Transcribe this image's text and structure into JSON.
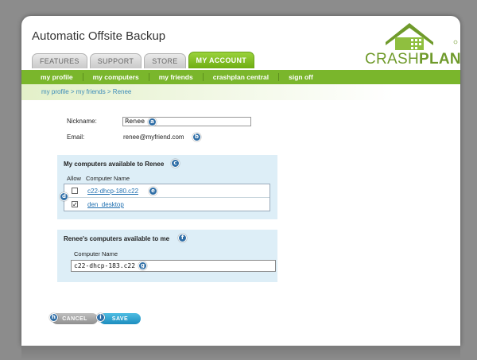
{
  "app": {
    "title": "Automatic Offsite Backup"
  },
  "logo": {
    "crash": "CRASH",
    "plan": "PLAN"
  },
  "tabs": [
    {
      "label": "FEATURES",
      "active": false
    },
    {
      "label": "SUPPORT",
      "active": false
    },
    {
      "label": "STORE",
      "active": false
    },
    {
      "label": "MY ACCOUNT",
      "active": true
    }
  ],
  "nav": [
    {
      "label": "my profile"
    },
    {
      "label": "my computers"
    },
    {
      "label": "my friends"
    },
    {
      "label": "crashplan central"
    },
    {
      "label": "sign off"
    }
  ],
  "breadcrumb": "my profile > my friends > Renee",
  "form": {
    "nickname_label": "Nickname:",
    "nickname_value": "Renee",
    "email_label": "Email:",
    "email_value": "renee@myfriend.com"
  },
  "available_to_friend": {
    "title": "My computers available to Renee",
    "headers": {
      "allow": "Allow",
      "name": "Computer Name"
    },
    "rows": [
      {
        "allowed": false,
        "check": "",
        "name": "c22-dhcp-180.c22"
      },
      {
        "allowed": true,
        "check": "✓",
        "name": "den_desktop"
      }
    ]
  },
  "available_to_me": {
    "title": "Renee's computers available to me",
    "header": "Computer Name",
    "value": "c22-dhcp-183.c22"
  },
  "buttons": {
    "cancel": "CANCEL",
    "save": "SAVE"
  },
  "badges": {
    "a": "a",
    "b": "b",
    "c": "c",
    "d": "d",
    "e": "e",
    "f": "f",
    "g": "g",
    "h": "h",
    "i": "i"
  },
  "colors": {
    "brand_green": "#7ab62c",
    "link_blue": "#1f6fb0",
    "panel_blue": "#ddeef7",
    "badge_blue": "#2f6ea6"
  }
}
